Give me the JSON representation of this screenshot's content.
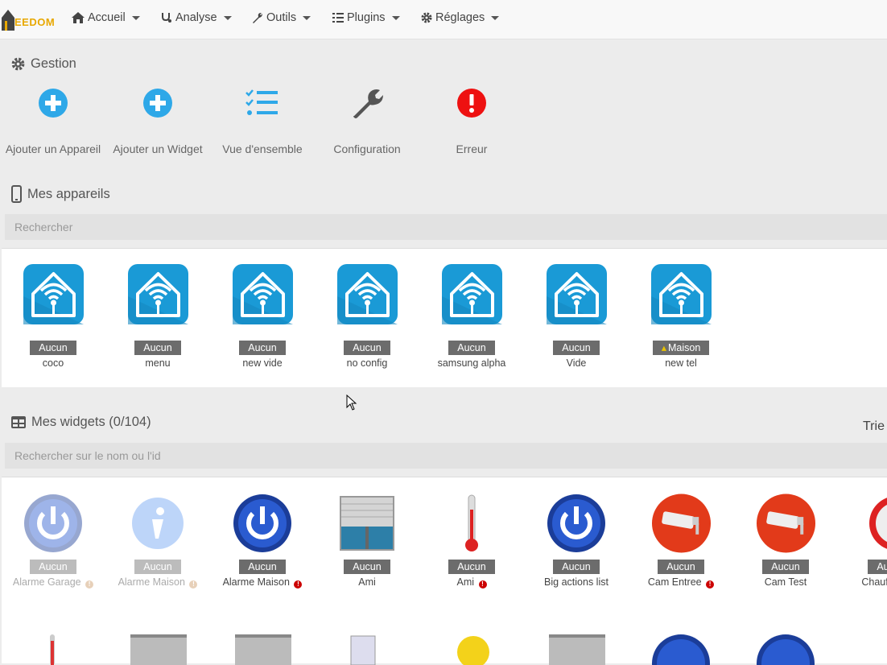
{
  "nav": {
    "logo_text": "EEDOM",
    "items": [
      {
        "label": "Accueil",
        "icon": "home-icon"
      },
      {
        "label": "Analyse",
        "icon": "stethoscope-icon"
      },
      {
        "label": "Outils",
        "icon": "wrench-icon"
      },
      {
        "label": "Plugins",
        "icon": "tasks-icon"
      },
      {
        "label": "Réglages",
        "icon": "gear-icon"
      }
    ]
  },
  "gestion": {
    "title": "Gestion",
    "actions": [
      {
        "label": "Ajouter un Appareil",
        "icon": "plus-circle-icon",
        "color": "#2ea8e8"
      },
      {
        "label": "Ajouter un Widget",
        "icon": "plus-circle-icon",
        "color": "#2ea8e8"
      },
      {
        "label": "Vue d'ensemble",
        "icon": "list-check-icon",
        "color": "#2ea8e8"
      },
      {
        "label": "Configuration",
        "icon": "wrench-icon",
        "color": "#555555"
      },
      {
        "label": "Erreur",
        "icon": "exclamation-circle-icon",
        "color": "#ee1111"
      }
    ]
  },
  "devices": {
    "title": "Mes appareils",
    "search_placeholder": "Rechercher",
    "items": [
      {
        "badge": "Aucun",
        "name": "coco"
      },
      {
        "badge": "Aucun",
        "name": "menu"
      },
      {
        "badge": "Aucun",
        "name": "new vide"
      },
      {
        "badge": "Aucun",
        "name": "no config"
      },
      {
        "badge": "Aucun",
        "name": "samsung alpha"
      },
      {
        "badge": "Aucun",
        "name": "Vide"
      },
      {
        "badge": "Maison",
        "name": "new tel"
      }
    ]
  },
  "widgets": {
    "title": "Mes widgets (0/104)",
    "sort_label": "Trie",
    "search_placeholder": "Rechercher sur le nom ou l'id",
    "items": [
      {
        "badge": "Aucun",
        "name": "Alarme Garage",
        "icon": "power-button-icon",
        "error": true,
        "faded": true
      },
      {
        "badge": "Aucun",
        "name": "Alarme Maison",
        "icon": "info-icon",
        "error": true,
        "faded": true
      },
      {
        "badge": "Aucun",
        "name": "Alarme Maison",
        "icon": "power-button-icon",
        "error": true,
        "faded": false
      },
      {
        "badge": "Aucun",
        "name": "Ami",
        "icon": "shutter-window-icon",
        "error": false,
        "faded": false
      },
      {
        "badge": "Aucun",
        "name": "Ami",
        "icon": "thermometer-icon",
        "error": true,
        "faded": false
      },
      {
        "badge": "Aucun",
        "name": "Big actions list",
        "icon": "power-button-icon",
        "error": false,
        "faded": false
      },
      {
        "badge": "Aucun",
        "name": "Cam Entree",
        "icon": "camera-icon",
        "error": true,
        "faded": false
      },
      {
        "badge": "Aucun",
        "name": "Cam Test",
        "icon": "camera-icon",
        "error": false,
        "faded": false
      },
      {
        "badge": "Au",
        "name": "Chauffe s",
        "icon": "gauge-icon",
        "error": false,
        "faded": false
      }
    ]
  }
}
